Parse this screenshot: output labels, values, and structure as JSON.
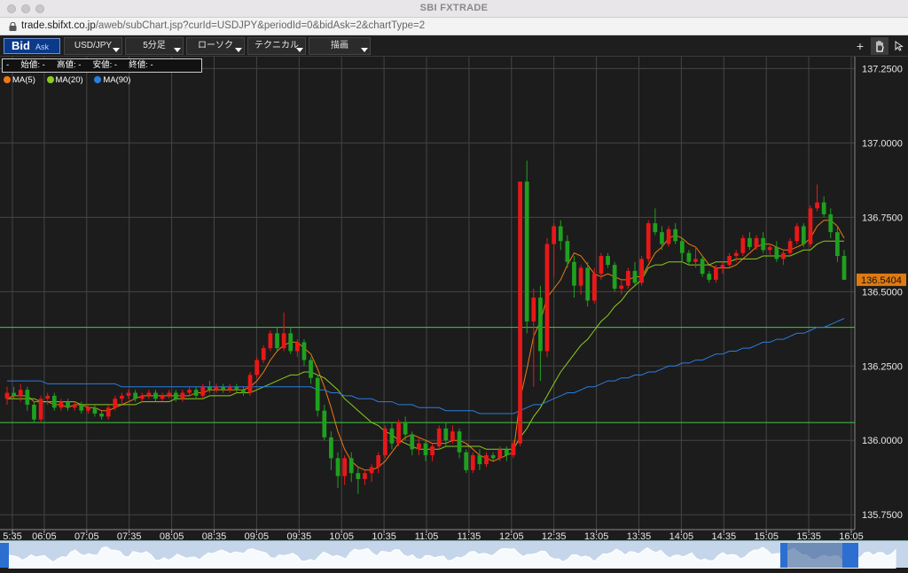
{
  "window": {
    "title": "SBI FXTRADE"
  },
  "browser": {
    "url_host": "trade.sbifxt.co.jp",
    "url_path": "/aweb/subChart.jsp?curId=USDJPY&periodId=0&bidAsk=2&chartType=2"
  },
  "toolbar": {
    "bid_label": "Bid",
    "ask_label": "Ask",
    "currency_pair": "USD/JPY",
    "period": "5分足",
    "chart_style": "ローソク",
    "technical": "テクニカル",
    "drawing": "描画"
  },
  "ohlc_readout": "-     始値: -     高値: -     安値: -     終値: -",
  "legend": [
    {
      "label": "MA(5)",
      "color": "#f07a10"
    },
    {
      "label": "MA(20)",
      "color": "#8ccc1a"
    },
    {
      "label": "MA(90)",
      "color": "#2a7de0"
    }
  ],
  "colors": {
    "up": "#e81818",
    "down": "#1fa01f",
    "bg": "#1c1c1c",
    "grid": "#444444",
    "hline": "#3ecf3e",
    "price_tag": "#e07a10"
  },
  "chart_data": {
    "type": "candlestick",
    "instrument": "USD/JPY",
    "timeframe": "5分足",
    "y_ticks": [
      "137.2500",
      "137.0000",
      "136.7500",
      "136.5000",
      "136.2500",
      "136.0000",
      "135.7500"
    ],
    "y_tick_values": [
      137.25,
      137.0,
      136.75,
      136.5,
      136.25,
      136.0,
      135.75
    ],
    "ylim": [
      135.7,
      137.29
    ],
    "x_ticks": [
      "5:35",
      "06:05",
      "07:05",
      "07:35",
      "08:05",
      "08:35",
      "09:05",
      "09:35",
      "10:05",
      "10:35",
      "11:05",
      "11:35",
      "12:05",
      "12:35",
      "13:05",
      "13:35",
      "14:05",
      "14:35",
      "15:05",
      "15:35",
      "16:05"
    ],
    "current_price": "136.5404",
    "horizontal_lines": [
      136.38,
      136.06
    ],
    "candles": [
      [
        136.14,
        136.18,
        136.12,
        136.16
      ],
      [
        136.16,
        136.18,
        136.14,
        136.15
      ],
      [
        136.15,
        136.19,
        136.13,
        136.17
      ],
      [
        136.17,
        136.18,
        136.1,
        136.12
      ],
      [
        136.12,
        136.13,
        136.06,
        136.07
      ],
      [
        136.07,
        136.15,
        136.06,
        136.14
      ],
      [
        136.14,
        136.16,
        136.12,
        136.15
      ],
      [
        136.15,
        136.16,
        136.1,
        136.11
      ],
      [
        136.11,
        136.14,
        136.1,
        136.13
      ],
      [
        136.13,
        136.14,
        136.1,
        136.11
      ],
      [
        136.11,
        136.13,
        136.1,
        136.12
      ],
      [
        136.12,
        136.13,
        136.09,
        136.1
      ],
      [
        136.1,
        136.12,
        136.09,
        136.11
      ],
      [
        136.11,
        136.12,
        136.08,
        136.09
      ],
      [
        136.09,
        136.1,
        136.07,
        136.08
      ],
      [
        136.08,
        136.12,
        136.07,
        136.11
      ],
      [
        136.11,
        136.15,
        136.1,
        136.14
      ],
      [
        136.14,
        136.16,
        136.12,
        136.15
      ],
      [
        136.15,
        136.17,
        136.14,
        136.16
      ],
      [
        136.16,
        136.17,
        136.13,
        136.14
      ],
      [
        136.14,
        136.16,
        136.13,
        136.15
      ],
      [
        136.15,
        136.17,
        136.14,
        136.16
      ],
      [
        136.16,
        136.17,
        136.13,
        136.14
      ],
      [
        136.14,
        136.16,
        136.13,
        136.15
      ],
      [
        136.15,
        136.17,
        136.14,
        136.16
      ],
      [
        136.16,
        136.17,
        136.13,
        136.14
      ],
      [
        136.14,
        136.17,
        136.13,
        136.16
      ],
      [
        136.16,
        136.18,
        136.15,
        136.17
      ],
      [
        136.17,
        136.18,
        136.14,
        136.15
      ],
      [
        136.15,
        136.19,
        136.14,
        136.18
      ],
      [
        136.18,
        136.2,
        136.16,
        136.17
      ],
      [
        136.17,
        136.19,
        136.16,
        136.18
      ],
      [
        136.18,
        136.19,
        136.16,
        136.17
      ],
      [
        136.17,
        136.19,
        136.16,
        136.18
      ],
      [
        136.18,
        136.19,
        136.16,
        136.17
      ],
      [
        136.17,
        136.18,
        136.15,
        136.16
      ],
      [
        136.16,
        136.23,
        136.15,
        136.22
      ],
      [
        136.22,
        136.28,
        136.21,
        136.27
      ],
      [
        136.27,
        136.32,
        136.26,
        136.31
      ],
      [
        136.31,
        136.37,
        136.3,
        136.36
      ],
      [
        136.36,
        136.38,
        136.3,
        136.31
      ],
      [
        136.31,
        136.43,
        136.3,
        136.36
      ],
      [
        136.36,
        136.38,
        136.29,
        136.3
      ],
      [
        136.3,
        136.34,
        136.28,
        136.33
      ],
      [
        136.33,
        136.34,
        136.25,
        136.27
      ],
      [
        136.27,
        136.28,
        136.19,
        136.21
      ],
      [
        136.21,
        136.22,
        136.08,
        136.1
      ],
      [
        136.1,
        136.12,
        136.0,
        136.01
      ],
      [
        136.01,
        136.03,
        135.9,
        135.94
      ],
      [
        135.94,
        135.96,
        135.84,
        135.88
      ],
      [
        135.88,
        135.95,
        135.85,
        135.94
      ],
      [
        135.94,
        135.96,
        135.86,
        135.89
      ],
      [
        135.89,
        135.91,
        135.82,
        135.87
      ],
      [
        135.87,
        135.9,
        135.85,
        135.89
      ],
      [
        135.89,
        135.92,
        135.86,
        135.91
      ],
      [
        135.91,
        135.96,
        135.89,
        135.95
      ],
      [
        135.95,
        136.05,
        135.94,
        136.04
      ],
      [
        136.04,
        136.06,
        135.97,
        135.99
      ],
      [
        135.99,
        136.07,
        135.98,
        136.06
      ],
      [
        136.06,
        136.08,
        136.0,
        136.02
      ],
      [
        136.02,
        136.03,
        135.95,
        135.97
      ],
      [
        135.97,
        136.01,
        135.95,
        135.99
      ],
      [
        135.99,
        136.0,
        135.93,
        135.95
      ],
      [
        135.95,
        135.99,
        135.93,
        135.98
      ],
      [
        135.98,
        136.05,
        135.97,
        136.04
      ],
      [
        136.04,
        136.06,
        135.98,
        136.0
      ],
      [
        136.0,
        136.05,
        135.99,
        136.03
      ],
      [
        136.03,
        136.04,
        135.94,
        135.96
      ],
      [
        135.96,
        135.97,
        135.89,
        135.9
      ],
      [
        135.9,
        135.96,
        135.89,
        135.95
      ],
      [
        135.95,
        135.97,
        135.9,
        135.92
      ],
      [
        135.92,
        135.96,
        135.91,
        135.95
      ],
      [
        135.95,
        135.96,
        135.93,
        135.94
      ],
      [
        135.94,
        135.98,
        135.93,
        135.97
      ],
      [
        135.97,
        135.98,
        135.93,
        135.95
      ],
      [
        135.95,
        136.0,
        135.94,
        135.99
      ],
      [
        135.99,
        136.87,
        135.98,
        136.87
      ],
      [
        136.87,
        136.94,
        136.36,
        136.4
      ],
      [
        136.4,
        136.51,
        136.18,
        136.48
      ],
      [
        136.48,
        136.52,
        136.2,
        136.3
      ],
      [
        136.3,
        136.68,
        136.28,
        136.66
      ],
      [
        136.66,
        136.73,
        136.55,
        136.72
      ],
      [
        136.72,
        136.74,
        136.64,
        136.67
      ],
      [
        136.67,
        136.69,
        136.58,
        136.6
      ],
      [
        136.6,
        136.62,
        136.48,
        136.52
      ],
      [
        136.52,
        136.59,
        136.49,
        136.58
      ],
      [
        136.58,
        136.6,
        136.45,
        136.47
      ],
      [
        136.47,
        136.58,
        136.46,
        136.56
      ],
      [
        136.56,
        136.63,
        136.54,
        136.62
      ],
      [
        136.62,
        136.63,
        136.58,
        136.59
      ],
      [
        136.59,
        136.6,
        136.5,
        136.51
      ],
      [
        136.51,
        136.54,
        136.49,
        136.52
      ],
      [
        136.52,
        136.58,
        136.51,
        136.57
      ],
      [
        136.57,
        136.6,
        136.52,
        136.53
      ],
      [
        136.53,
        136.62,
        136.52,
        136.61
      ],
      [
        136.61,
        136.74,
        136.6,
        136.73
      ],
      [
        136.73,
        136.78,
        136.69,
        136.7
      ],
      [
        136.7,
        136.72,
        136.64,
        136.66
      ],
      [
        136.66,
        136.72,
        136.65,
        136.71
      ],
      [
        136.71,
        136.73,
        136.66,
        136.67
      ],
      [
        136.67,
        136.68,
        136.6,
        136.63
      ],
      [
        136.63,
        136.64,
        136.59,
        136.6
      ],
      [
        136.6,
        136.65,
        136.58,
        136.61
      ],
      [
        136.61,
        136.62,
        136.55,
        136.56
      ],
      [
        136.56,
        136.57,
        136.53,
        136.54
      ],
      [
        136.54,
        136.59,
        136.53,
        136.58
      ],
      [
        136.58,
        136.6,
        136.56,
        136.59
      ],
      [
        136.59,
        136.63,
        136.58,
        136.62
      ],
      [
        136.62,
        136.64,
        136.6,
        136.63
      ],
      [
        136.63,
        136.69,
        136.62,
        136.68
      ],
      [
        136.68,
        136.7,
        136.64,
        136.65
      ],
      [
        136.65,
        136.69,
        136.64,
        136.68
      ],
      [
        136.68,
        136.7,
        136.63,
        136.64
      ],
      [
        136.64,
        136.66,
        136.62,
        136.65
      ],
      [
        136.65,
        136.67,
        136.6,
        136.61
      ],
      [
        136.61,
        136.64,
        136.59,
        136.63
      ],
      [
        136.63,
        136.68,
        136.62,
        136.67
      ],
      [
        136.67,
        136.73,
        136.66,
        136.72
      ],
      [
        136.72,
        136.73,
        136.65,
        136.66
      ],
      [
        136.66,
        136.79,
        136.65,
        136.78
      ],
      [
        136.78,
        136.86,
        136.77,
        136.8
      ],
      [
        136.8,
        136.82,
        136.75,
        136.76
      ],
      [
        136.76,
        136.78,
        136.68,
        136.7
      ],
      [
        136.7,
        136.72,
        136.6,
        136.62
      ],
      [
        136.62,
        136.64,
        136.54,
        136.54
      ]
    ],
    "ma_series": [
      {
        "name": "MA(5)",
        "color": "#f07a10",
        "values": [
          136.14,
          136.15,
          136.15,
          136.15,
          136.13,
          136.13,
          136.13,
          136.12,
          136.12,
          136.11,
          136.12,
          136.12,
          136.11,
          136.11,
          136.1,
          136.1,
          136.11,
          136.12,
          136.13,
          136.14,
          136.15,
          136.15,
          136.15,
          136.15,
          136.15,
          136.15,
          136.15,
          136.15,
          136.16,
          136.16,
          136.17,
          136.17,
          136.17,
          136.17,
          136.17,
          136.17,
          136.18,
          136.2,
          136.23,
          136.27,
          136.3,
          136.32,
          136.33,
          136.33,
          136.31,
          136.29,
          136.24,
          136.18,
          136.11,
          136.03,
          135.97,
          135.93,
          135.91,
          135.9,
          135.9,
          135.91,
          135.93,
          135.96,
          135.99,
          136.01,
          136.02,
          136.01,
          136.0,
          135.99,
          135.99,
          135.99,
          136.0,
          136.0,
          135.99,
          135.97,
          135.95,
          135.94,
          135.93,
          135.94,
          135.95,
          135.96,
          136.14,
          136.24,
          136.35,
          136.4,
          136.48,
          136.51,
          136.54,
          136.59,
          136.63,
          136.62,
          136.59,
          136.56,
          136.55,
          136.56,
          136.55,
          136.54,
          136.54,
          136.55,
          136.55,
          136.59,
          136.63,
          136.65,
          136.68,
          136.69,
          136.68,
          136.66,
          136.65,
          136.62,
          136.59,
          136.58,
          136.58,
          136.58,
          136.59,
          136.61,
          136.63,
          136.65,
          136.66,
          136.66,
          136.65,
          136.64,
          136.64,
          136.65,
          136.66,
          136.68,
          136.72,
          136.74,
          136.74,
          136.72,
          136.68
        ]
      },
      {
        "name": "MA(20)",
        "color": "#8ccc1a",
        "values": [
          136.14,
          136.14,
          136.14,
          136.14,
          136.14,
          136.13,
          136.13,
          136.13,
          136.13,
          136.13,
          136.13,
          136.12,
          136.12,
          136.12,
          136.12,
          136.12,
          136.12,
          136.12,
          136.12,
          136.12,
          136.13,
          136.13,
          136.13,
          136.13,
          136.13,
          136.14,
          136.14,
          136.14,
          136.14,
          136.14,
          136.15,
          136.15,
          136.15,
          136.15,
          136.16,
          136.16,
          136.16,
          136.17,
          136.18,
          136.19,
          136.2,
          136.21,
          136.22,
          136.22,
          136.23,
          136.23,
          136.22,
          136.21,
          136.19,
          136.17,
          136.14,
          136.12,
          136.1,
          136.08,
          136.06,
          136.05,
          136.03,
          136.02,
          136.0,
          135.99,
          135.98,
          135.97,
          135.97,
          135.97,
          135.97,
          135.98,
          135.98,
          135.98,
          135.98,
          135.98,
          135.98,
          135.97,
          135.97,
          135.97,
          135.97,
          135.97,
          136.01,
          136.04,
          136.08,
          136.11,
          136.15,
          136.19,
          136.23,
          136.26,
          136.29,
          136.32,
          136.34,
          136.37,
          136.4,
          136.42,
          136.45,
          136.47,
          136.5,
          136.52,
          136.54,
          136.58,
          136.59,
          136.59,
          136.6,
          136.6,
          136.6,
          136.59,
          136.59,
          136.59,
          136.59,
          136.6,
          136.6,
          136.6,
          136.61,
          136.61,
          136.61,
          136.61,
          136.62,
          136.62,
          136.62,
          136.62,
          136.62,
          136.63,
          136.64,
          136.64,
          136.66,
          136.67,
          136.67,
          136.67,
          136.67
        ]
      },
      {
        "name": "MA(90)",
        "color": "#2a7de0",
        "values": [
          136.2,
          136.2,
          136.2,
          136.2,
          136.2,
          136.2,
          136.19,
          136.19,
          136.19,
          136.19,
          136.19,
          136.19,
          136.19,
          136.19,
          136.19,
          136.19,
          136.19,
          136.18,
          136.18,
          136.18,
          136.18,
          136.18,
          136.18,
          136.18,
          136.18,
          136.18,
          136.18,
          136.18,
          136.18,
          136.18,
          136.18,
          136.18,
          136.18,
          136.18,
          136.18,
          136.18,
          136.18,
          136.18,
          136.18,
          136.18,
          136.18,
          136.18,
          136.18,
          136.18,
          136.18,
          136.18,
          136.17,
          136.17,
          136.16,
          136.16,
          136.15,
          136.15,
          136.14,
          136.14,
          136.14,
          136.13,
          136.13,
          136.13,
          136.12,
          136.12,
          136.12,
          136.11,
          136.11,
          136.11,
          136.11,
          136.1,
          136.1,
          136.1,
          136.1,
          136.1,
          136.09,
          136.09,
          136.09,
          136.09,
          136.09,
          136.09,
          136.1,
          136.11,
          136.12,
          136.12,
          136.13,
          136.14,
          136.15,
          136.16,
          136.16,
          136.17,
          136.18,
          136.18,
          136.19,
          136.2,
          136.2,
          136.21,
          136.21,
          136.22,
          136.22,
          136.23,
          136.23,
          136.24,
          136.25,
          136.25,
          136.26,
          136.26,
          136.27,
          136.27,
          136.28,
          136.29,
          136.29,
          136.3,
          136.3,
          136.31,
          136.31,
          136.32,
          136.33,
          136.33,
          136.34,
          136.34,
          136.35,
          136.36,
          136.36,
          136.37,
          136.38,
          136.38,
          136.39,
          136.4,
          136.41
        ]
      }
    ]
  }
}
